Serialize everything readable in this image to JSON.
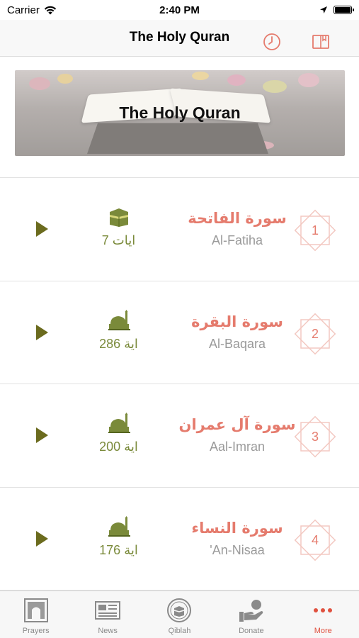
{
  "status_bar": {
    "carrier": "Carrier",
    "time": "2:40 PM"
  },
  "nav": {
    "title": "The Holy Quran",
    "history_icon": "clock-icon",
    "bookmark_icon": "book-bookmark-icon"
  },
  "banner": {
    "title": "The Holy Quran"
  },
  "surahs": [
    {
      "number": "1",
      "arabic": "سورة الفاتحة",
      "english": "Al-Fatiha",
      "ayat": "7 ايات",
      "place_icon": "kaaba-icon"
    },
    {
      "number": "2",
      "arabic": "سورة البقرة",
      "english": "Al-Baqara",
      "ayat": "286 اية",
      "place_icon": "mosque-icon"
    },
    {
      "number": "3",
      "arabic": "سورة آل عمران",
      "english": "Aal-Imran",
      "ayat": "200 اية",
      "place_icon": "mosque-icon"
    },
    {
      "number": "4",
      "arabic": "سورة النساء",
      "english": "'An-Nisaa",
      "ayat": "176 اية",
      "place_icon": "mosque-icon"
    }
  ],
  "tabs": [
    {
      "label": "Prayers",
      "icon": "prayer-mat-icon"
    },
    {
      "label": "News",
      "icon": "newspaper-icon"
    },
    {
      "label": "Qiblah",
      "icon": "compass-kaaba-icon"
    },
    {
      "label": "Donate",
      "icon": "donate-hand-icon"
    },
    {
      "label": "More",
      "icon": "more-dots-icon"
    }
  ],
  "colors": {
    "accent": "#e57b6d",
    "ayat_green": "#7a8a3a",
    "play": "#6b6b1e",
    "tab_active": "#e0513f"
  }
}
